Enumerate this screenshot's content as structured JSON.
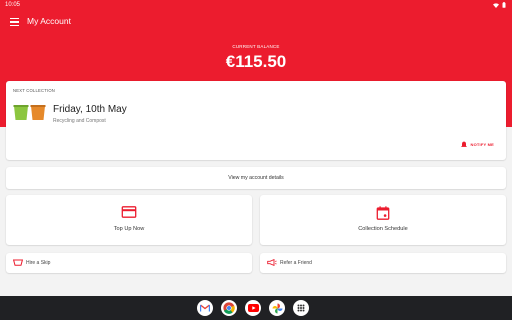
{
  "status_bar": {
    "time": "10:05"
  },
  "app_bar": {
    "title": "My Account"
  },
  "balance": {
    "label": "CURRENT BALANCE",
    "value": "€115.50"
  },
  "next_collection": {
    "label": "NEXT COLLECTION",
    "date": "Friday, 10th May",
    "types": "Recycling and Compost",
    "notify_label": "NOTIFY ME",
    "bin_colors": [
      "#8cc63f",
      "#e6892a"
    ]
  },
  "account_details": {
    "label": "View my account details"
  },
  "tiles": {
    "top_up": {
      "label": "Top Up Now",
      "icon": "card-icon"
    },
    "schedule": {
      "label": "Collection Schedule",
      "icon": "calendar-icon"
    }
  },
  "small_cards": {
    "hire_skip": {
      "label": "Hire a Skip",
      "icon": "skip-icon"
    },
    "refer_friend": {
      "label": "Refer a Friend",
      "icon": "megaphone-icon"
    }
  },
  "dock_apps": [
    "gmail-icon",
    "chrome-icon",
    "youtube-icon",
    "photos-icon",
    "app-drawer-icon"
  ],
  "colors": {
    "brand_red": "#ec1c2e",
    "nav_bar": "#202124"
  }
}
